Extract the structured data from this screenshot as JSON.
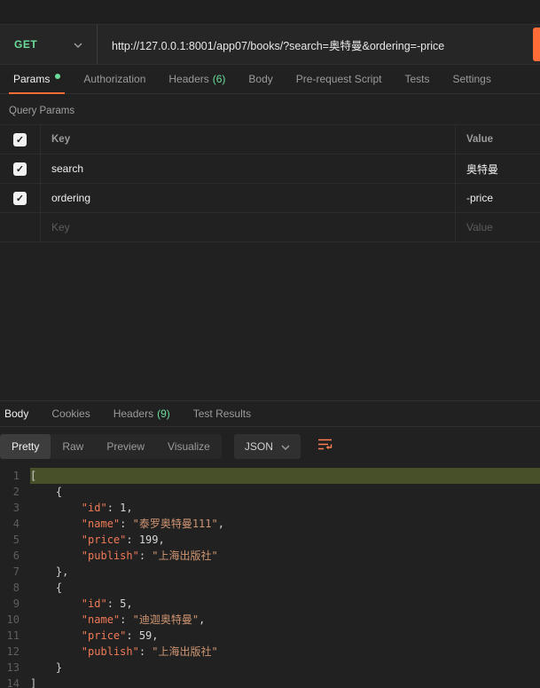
{
  "request": {
    "method": "GET",
    "url": "http://127.0.0.1:8001/app07/books/?search=奥特曼&ordering=-price"
  },
  "request_tabs": [
    {
      "label": "Params"
    },
    {
      "label": "Authorization"
    },
    {
      "label": "Headers",
      "count": "(6)"
    },
    {
      "label": "Body"
    },
    {
      "label": "Pre-request Script"
    },
    {
      "label": "Tests"
    },
    {
      "label": "Settings"
    }
  ],
  "query_params": {
    "title": "Query Params",
    "columns": {
      "key": "Key",
      "value": "Value"
    },
    "rows": [
      {
        "key": "search",
        "value": "奥特曼"
      },
      {
        "key": "ordering",
        "value": "-price"
      }
    ],
    "placeholder": {
      "key": "Key",
      "value": "Value"
    }
  },
  "response": {
    "tabs": [
      {
        "label": "Body"
      },
      {
        "label": "Cookies"
      },
      {
        "label": "Headers",
        "count": "(9)"
      },
      {
        "label": "Test Results"
      }
    ],
    "view_tabs": [
      {
        "label": "Pretty"
      },
      {
        "label": "Raw"
      },
      {
        "label": "Preview"
      },
      {
        "label": "Visualize"
      }
    ],
    "format": "JSON",
    "code": {
      "lines": [
        {
          "n": 1,
          "hl": true,
          "tokens": [
            {
              "t": "[",
              "c": "p"
            }
          ]
        },
        {
          "n": 2,
          "tokens": [
            {
              "t": "    {",
              "c": "p"
            }
          ]
        },
        {
          "n": 3,
          "tokens": [
            {
              "t": "        ",
              "c": "p"
            },
            {
              "t": "\"id\"",
              "c": "k"
            },
            {
              "t": ": ",
              "c": "p"
            },
            {
              "t": "1",
              "c": "n"
            },
            {
              "t": ",",
              "c": "p"
            }
          ]
        },
        {
          "n": 4,
          "tokens": [
            {
              "t": "        ",
              "c": "p"
            },
            {
              "t": "\"name\"",
              "c": "k"
            },
            {
              "t": ": ",
              "c": "p"
            },
            {
              "t": "\"泰罗奥特曼111\"",
              "c": "s"
            },
            {
              "t": ",",
              "c": "p"
            }
          ]
        },
        {
          "n": 5,
          "tokens": [
            {
              "t": "        ",
              "c": "p"
            },
            {
              "t": "\"price\"",
              "c": "k"
            },
            {
              "t": ": ",
              "c": "p"
            },
            {
              "t": "199",
              "c": "n"
            },
            {
              "t": ",",
              "c": "p"
            }
          ]
        },
        {
          "n": 6,
          "tokens": [
            {
              "t": "        ",
              "c": "p"
            },
            {
              "t": "\"publish\"",
              "c": "k"
            },
            {
              "t": ": ",
              "c": "p"
            },
            {
              "t": "\"上海出版社\"",
              "c": "s"
            }
          ]
        },
        {
          "n": 7,
          "tokens": [
            {
              "t": "    },",
              "c": "p"
            }
          ]
        },
        {
          "n": 8,
          "tokens": [
            {
              "t": "    {",
              "c": "p"
            }
          ]
        },
        {
          "n": 9,
          "tokens": [
            {
              "t": "        ",
              "c": "p"
            },
            {
              "t": "\"id\"",
              "c": "k"
            },
            {
              "t": ": ",
              "c": "p"
            },
            {
              "t": "5",
              "c": "n"
            },
            {
              "t": ",",
              "c": "p"
            }
          ]
        },
        {
          "n": 10,
          "tokens": [
            {
              "t": "        ",
              "c": "p"
            },
            {
              "t": "\"name\"",
              "c": "k"
            },
            {
              "t": ": ",
              "c": "p"
            },
            {
              "t": "\"迪迦奥特曼\"",
              "c": "s"
            },
            {
              "t": ",",
              "c": "p"
            }
          ]
        },
        {
          "n": 11,
          "tokens": [
            {
              "t": "        ",
              "c": "p"
            },
            {
              "t": "\"price\"",
              "c": "k"
            },
            {
              "t": ": ",
              "c": "p"
            },
            {
              "t": "59",
              "c": "n"
            },
            {
              "t": ",",
              "c": "p"
            }
          ]
        },
        {
          "n": 12,
          "tokens": [
            {
              "t": "        ",
              "c": "p"
            },
            {
              "t": "\"publish\"",
              "c": "k"
            },
            {
              "t": ": ",
              "c": "p"
            },
            {
              "t": "\"上海出版社\"",
              "c": "s"
            }
          ]
        },
        {
          "n": 13,
          "tokens": [
            {
              "t": "    }",
              "c": "p"
            }
          ]
        },
        {
          "n": 14,
          "tokens": [
            {
              "t": "]",
              "c": "p"
            }
          ]
        }
      ]
    }
  },
  "colors": {
    "accent_orange": "#ff6c37",
    "method_green": "#6bdd9a",
    "count_green": "#6bdd9a",
    "json_key": "#f07a57",
    "json_string": "#cf9572",
    "highlight_line": "#475029"
  }
}
